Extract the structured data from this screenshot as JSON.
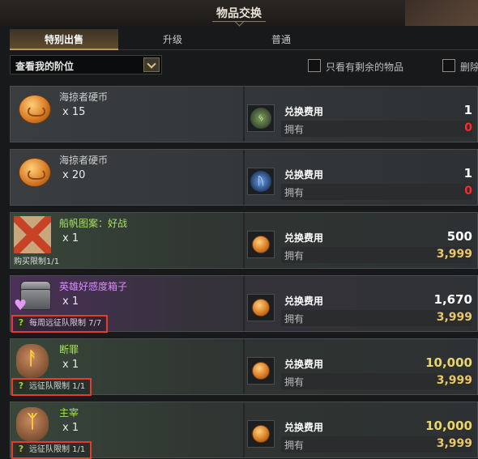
{
  "window": {
    "title": "物品交换"
  },
  "tabs": [
    {
      "label": "特别出售",
      "active": true
    },
    {
      "label": "升级",
      "active": false
    },
    {
      "label": "普通",
      "active": false
    }
  ],
  "filters": {
    "dropdown_value": "查看我的阶位",
    "checkbox1_label": "只看有剩余的物品",
    "checkbox2_label": "删除"
  },
  "colors": {
    "highlight_box": "#e43d2b",
    "gold_text": "#e9c66a",
    "zero_text": "#ff2b2b",
    "green_name": "#a6e060",
    "purple_name": "#d98bff"
  },
  "items": [
    {
      "name": "海掠者硬币",
      "qty": "x 15",
      "icon": "coin-icon",
      "limit": "",
      "cost_icon": "green-rune-icon",
      "cost_label": "兑换费用",
      "cost": "1",
      "own_label": "拥有",
      "own": "0"
    },
    {
      "name": "海掠者硬币",
      "qty": "x 20",
      "icon": "coin-icon",
      "limit": "",
      "cost_icon": "blue-rune-icon",
      "cost_label": "兑换费用",
      "cost": "1",
      "own_label": "拥有",
      "own": "0"
    },
    {
      "name": "船帆图案：好战",
      "qty": "x 1",
      "icon": "sail-pattern-icon",
      "limit": "购买限制1/1",
      "cost_icon": "coin-icon",
      "cost_label": "兑换费用",
      "cost": "500",
      "own_label": "拥有",
      "own": "3,999"
    },
    {
      "name": "英雄好感度箱子",
      "qty": "x 1",
      "icon": "chest-icon",
      "limit": "每周远征队限制 7/7",
      "cost_icon": "coin-icon",
      "cost_label": "兑换费用",
      "cost": "1,670",
      "own_label": "拥有",
      "own": "3,999"
    },
    {
      "name": "断罪",
      "qty": "x 1",
      "icon": "rune-icon",
      "limit": "远征队限制 1/1",
      "cost_icon": "coin-icon",
      "cost_label": "兑换费用",
      "cost": "10,000",
      "own_label": "拥有",
      "own": "3,999"
    },
    {
      "name": "主宰",
      "qty": "x 1",
      "icon": "rune-icon",
      "limit": "远征队限制 1/1",
      "cost_icon": "coin-icon",
      "cost_label": "兑换费用",
      "cost": "10,000",
      "own_label": "拥有",
      "own": "3,999"
    }
  ],
  "glyphs": {
    "help": "?",
    "rune1": "ᚨ",
    "rune2": "ᛉ",
    "heart": "♥",
    "green_rune": "ᛃ",
    "blue_rune": "ᚢ"
  }
}
